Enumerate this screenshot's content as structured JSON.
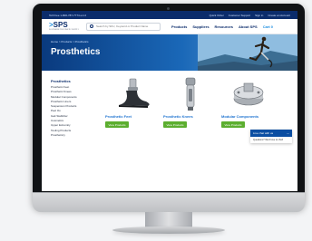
{
  "topbar": {
    "phone": "Toll Free 1-800-787-7774 ext 2",
    "links": [
      "Quick Order",
      "Customer Support",
      "Sign in",
      "Create an Account"
    ]
  },
  "header": {
    "logo_text": "SPS",
    "logo_sub": "SOUTHERN PROSTHETIC SUPPLY",
    "search_placeholder": "Search by SKU, Keyword or Product Name",
    "nav": [
      "Products",
      "Suppliers",
      "Resources",
      "About SPS"
    ],
    "cart": "Cart 0"
  },
  "hero": {
    "breadcrumb": "Home  >  Products  >  Prosthetics",
    "title": "Prosthetics"
  },
  "sidebar": {
    "title": "Prosthetics",
    "items": [
      "Prosthetic Feet",
      "Prosthetic Knees",
      "Modular Components",
      "Prosthetic Liners",
      "Suspension Products",
      "Peel Oo",
      "Gait Stabilizer",
      "Cosmetics",
      "Upper Extremity",
      "Tooling Products",
      "Prostheticry"
    ]
  },
  "cards": [
    {
      "title": "Prosthetic Feet",
      "button": "View Products"
    },
    {
      "title": "Prosthetic Knees",
      "button": "View Products"
    },
    {
      "title": "Modular Components",
      "button": "View Products"
    }
  ],
  "chat": {
    "title": "Live chat with us",
    "body": "Questions? We'd love to chat!"
  },
  "colors": {
    "brand_navy": "#0b2c6b",
    "link_blue": "#1e73d0",
    "button_green": "#5cae2f"
  }
}
